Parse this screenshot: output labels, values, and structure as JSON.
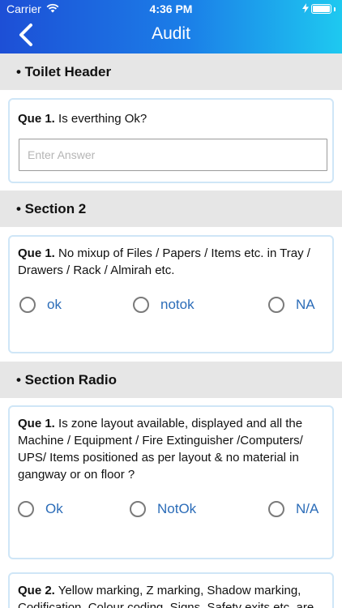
{
  "status_bar": {
    "carrier": "Carrier",
    "time": "4:36 PM"
  },
  "nav": {
    "title": "Audit",
    "back_icon": "chevron-left-icon"
  },
  "sections": [
    {
      "title": "• Toilet Header",
      "questions": [
        {
          "prefix": "Que 1.",
          "text": " Is everthing Ok?",
          "answer_placeholder": "Enter Answer",
          "answer_value": ""
        }
      ]
    },
    {
      "title": "• Section 2",
      "questions": [
        {
          "prefix": "Que 1.",
          "text": " No mixup of Files / Papers / Items etc. in Tray / Drawers / Rack / Almirah etc.",
          "options": [
            "ok",
            "notok",
            "NA"
          ],
          "selected": null
        }
      ]
    },
    {
      "title": "• Section Radio",
      "questions": [
        {
          "prefix": "Que 1.",
          "text": " Is zone layout available, displayed and all the Machine / Equipment / Fire Extinguisher /Computers/ UPS/ Items positioned as per layout & no material in gangway or on floor ?",
          "options": [
            "Ok",
            "NotOk",
            "N/A"
          ],
          "selected": null
        },
        {
          "prefix": "Que 2.",
          "text": " Yellow marking, Z marking, Shadow marking, Codification, Colour coding, Signs, Safety exits etc. are"
        }
      ]
    }
  ],
  "colors": {
    "nav_start": "#1d4fd6",
    "nav_end": "#1ec9f0",
    "card_border": "#cfe6f7",
    "option_text": "#2b6cb8",
    "section_bg": "#e6e6e6"
  }
}
